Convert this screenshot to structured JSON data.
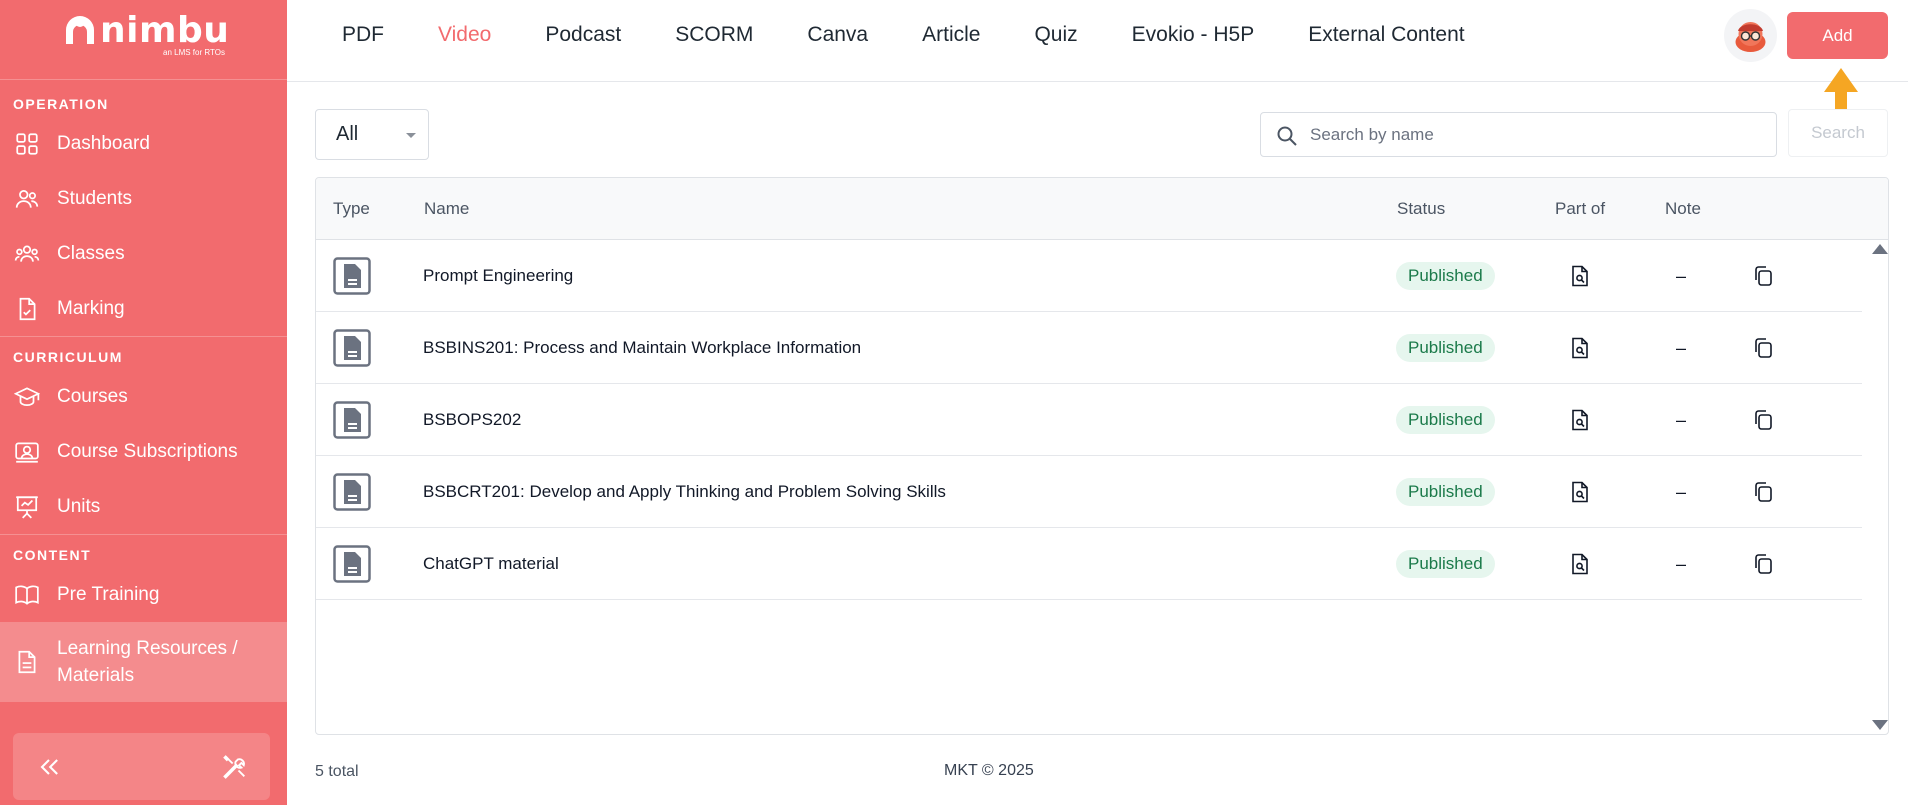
{
  "brand": {
    "name": "nimbu",
    "tagline": "an LMS for RTOs",
    "color": "#f26b6e"
  },
  "sidebar": {
    "sections": [
      {
        "label": "OPERATION",
        "items": [
          {
            "label": "Dashboard",
            "icon": "grid-icon"
          },
          {
            "label": "Students",
            "icon": "users-icon"
          },
          {
            "label": "Classes",
            "icon": "group-icon"
          },
          {
            "label": "Marking",
            "icon": "document-check-icon"
          }
        ]
      },
      {
        "label": "CURRICULUM",
        "items": [
          {
            "label": "Courses",
            "icon": "graduation-cap-icon"
          },
          {
            "label": "Course Subscriptions",
            "icon": "subscription-icon"
          },
          {
            "label": "Units",
            "icon": "presentation-icon"
          }
        ]
      },
      {
        "label": "CONTENT",
        "items": [
          {
            "label": "Pre Training",
            "icon": "book-icon"
          },
          {
            "label": "Learning Resources / Materials",
            "icon": "file-text-icon",
            "active": true
          }
        ]
      }
    ]
  },
  "topbar": {
    "tabs": [
      {
        "label": "PDF"
      },
      {
        "label": "Video",
        "active": true
      },
      {
        "label": "Podcast"
      },
      {
        "label": "SCORM"
      },
      {
        "label": "Canva"
      },
      {
        "label": "Article"
      },
      {
        "label": "Quiz"
      },
      {
        "label": "Evokio - H5P"
      },
      {
        "label": "External Content"
      }
    ],
    "add_label": "Add"
  },
  "filters": {
    "type_selected": "All",
    "search_placeholder": "Search by name",
    "search_value": "",
    "search_button": "Search"
  },
  "table": {
    "columns": [
      "Type",
      "Name",
      "Status",
      "Part of",
      "Note"
    ],
    "rows": [
      {
        "name": "Prompt Engineering",
        "status": "Published",
        "note": "–"
      },
      {
        "name": "BSBINS201: Process and Maintain Workplace Information",
        "status": "Published",
        "note": "–"
      },
      {
        "name": "BSBOPS202",
        "status": "Published",
        "note": "–"
      },
      {
        "name": "BSBCRT201: Develop and Apply Thinking and Problem Solving Skills",
        "status": "Published",
        "note": "–"
      },
      {
        "name": "ChatGPT material",
        "status": "Published",
        "note": "–"
      }
    ]
  },
  "footer": {
    "total": "5 total",
    "copyright": "MKT © 2025"
  },
  "colors": {
    "accent": "#f26b6e",
    "published_bg": "#e6f6ee",
    "published_text": "#1b7a4a",
    "arrow": "#f5a623"
  }
}
